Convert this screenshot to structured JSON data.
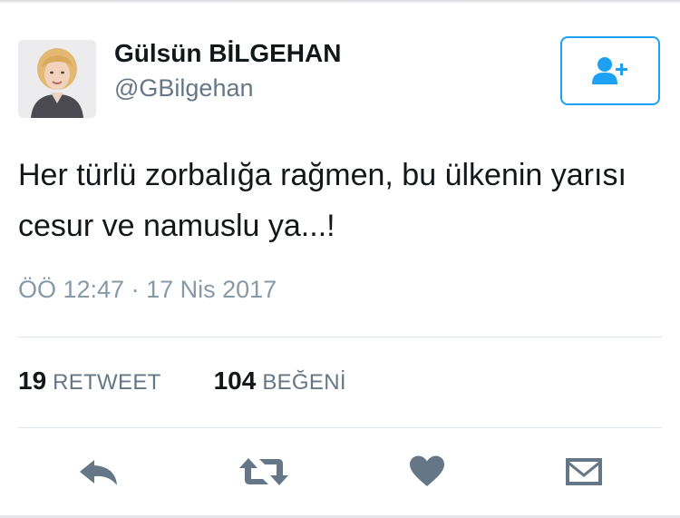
{
  "user": {
    "display_name": "Gülsün BİLGEHAN",
    "handle": "@GBilgehan"
  },
  "tweet": {
    "text": "Her türlü zorbalığa rağmen, bu ülkenin yarısı cesur ve namuslu ya...!",
    "timestamp": "ÖÖ 12:47 · 17 Nis 2017"
  },
  "stats": {
    "retweet_count": "19",
    "retweet_label": "RETWEET",
    "like_count": "104",
    "like_label": "BEĞENİ"
  },
  "icons": {
    "follow": "add-user-icon",
    "reply": "reply-icon",
    "retweet": "retweet-icon",
    "like": "heart-icon",
    "dm": "envelope-icon"
  },
  "colors": {
    "accent": "#1da1f2",
    "icon_gray": "#657786",
    "muted_text": "#8899a6",
    "divider": "#e1e8ed"
  }
}
